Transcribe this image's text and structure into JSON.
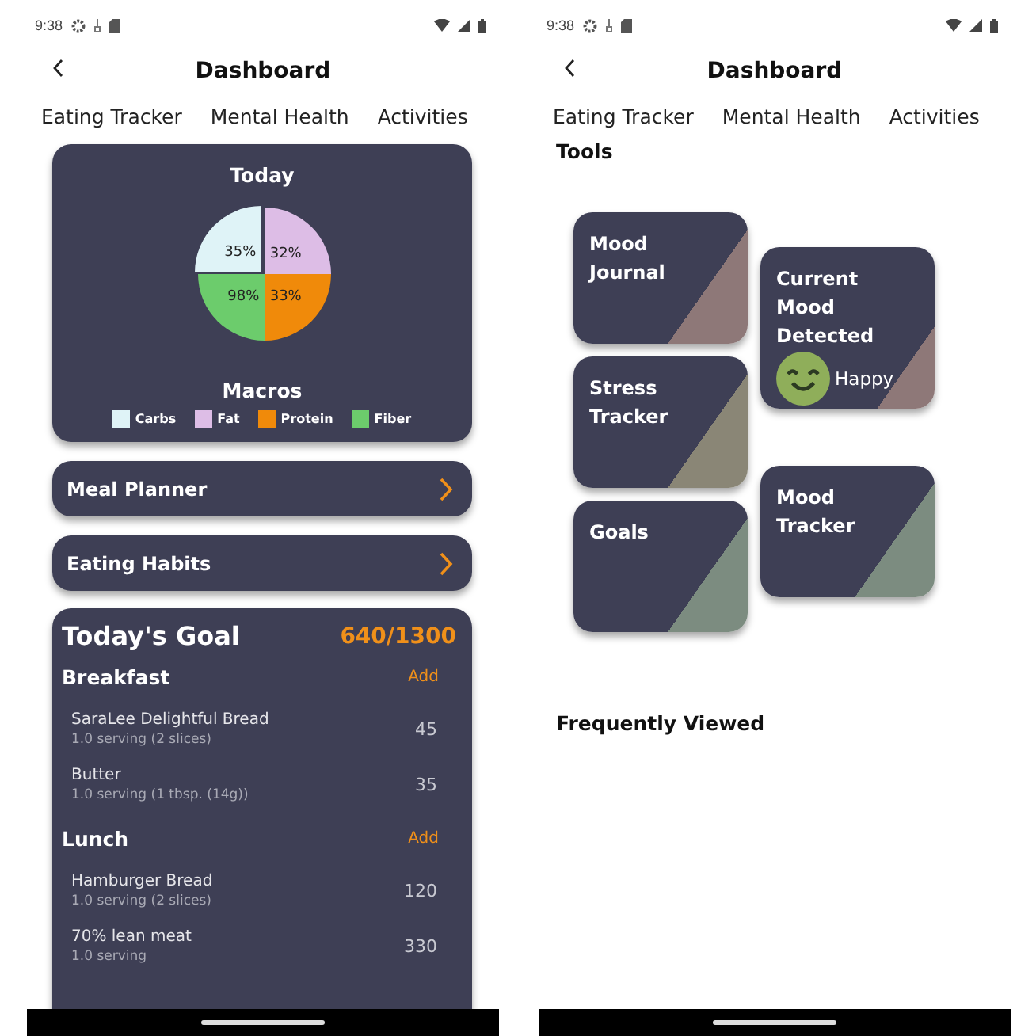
{
  "screens": [
    {
      "status_bar": {
        "time": "9:38"
      },
      "header": {
        "title": "Dashboard"
      },
      "tabs": [
        {
          "label": "Eating Tracker"
        },
        {
          "label": "Mental Health"
        },
        {
          "label": "Activities"
        }
      ],
      "today_card": {
        "chart_data": {
          "type": "pie",
          "title": "Today",
          "categories": [
            "Carbs",
            "Fat",
            "Protein",
            "Fiber"
          ],
          "colors": [
            "#dff3f7",
            "#ddbde6",
            "#f08a0a",
            "#6ccc6c"
          ],
          "value_labels": [
            "35%",
            "32%",
            "33%",
            "98%"
          ]
        },
        "legend_title": "Macros"
      },
      "links": [
        {
          "label": "Meal Planner"
        },
        {
          "label": "Eating Habits"
        }
      ],
      "goal": {
        "title": "Today's Goal",
        "progress": "640/1300",
        "meals": [
          {
            "name": "Breakfast",
            "action": "Add",
            "items": [
              {
                "name": "SaraLee Delightful Bread",
                "serving": "1.0 serving (2 slices)",
                "calories": "45"
              },
              {
                "name": "Butter",
                "serving": "1.0 serving (1 tbsp. (14g))",
                "calories": "35"
              }
            ]
          },
          {
            "name": "Lunch",
            "action": "Add",
            "items": [
              {
                "name": "Hamburger Bread",
                "serving": "1.0 serving (2 slices)",
                "calories": "120"
              },
              {
                "name": "70% lean meat",
                "serving": "1.0 serving",
                "calories": "330"
              }
            ]
          }
        ]
      }
    },
    {
      "status_bar": {
        "time": "9:38"
      },
      "header": {
        "title": "Dashboard"
      },
      "tabs": [
        {
          "label": "Eating Tracker"
        },
        {
          "label": "Mental Health"
        },
        {
          "label": "Activities"
        }
      ],
      "tools_title": "Tools",
      "tool_columns": [
        [
          {
            "kind": "link",
            "title": "Mood Journal",
            "color": "#8e7878"
          },
          {
            "kind": "link",
            "title": "Stress Tracker",
            "color": "#8a8676"
          },
          {
            "kind": "link",
            "title": "Goals",
            "color": "#7c8c80"
          }
        ],
        [
          {
            "kind": "mood",
            "title": "Current Mood Detected",
            "mood": "Happy",
            "color": "#8e7878"
          },
          {
            "kind": "link",
            "title": "Mood Tracker",
            "color": "#7c8c80"
          }
        ]
      ],
      "recent_title": "Frequently Viewed"
    }
  ]
}
